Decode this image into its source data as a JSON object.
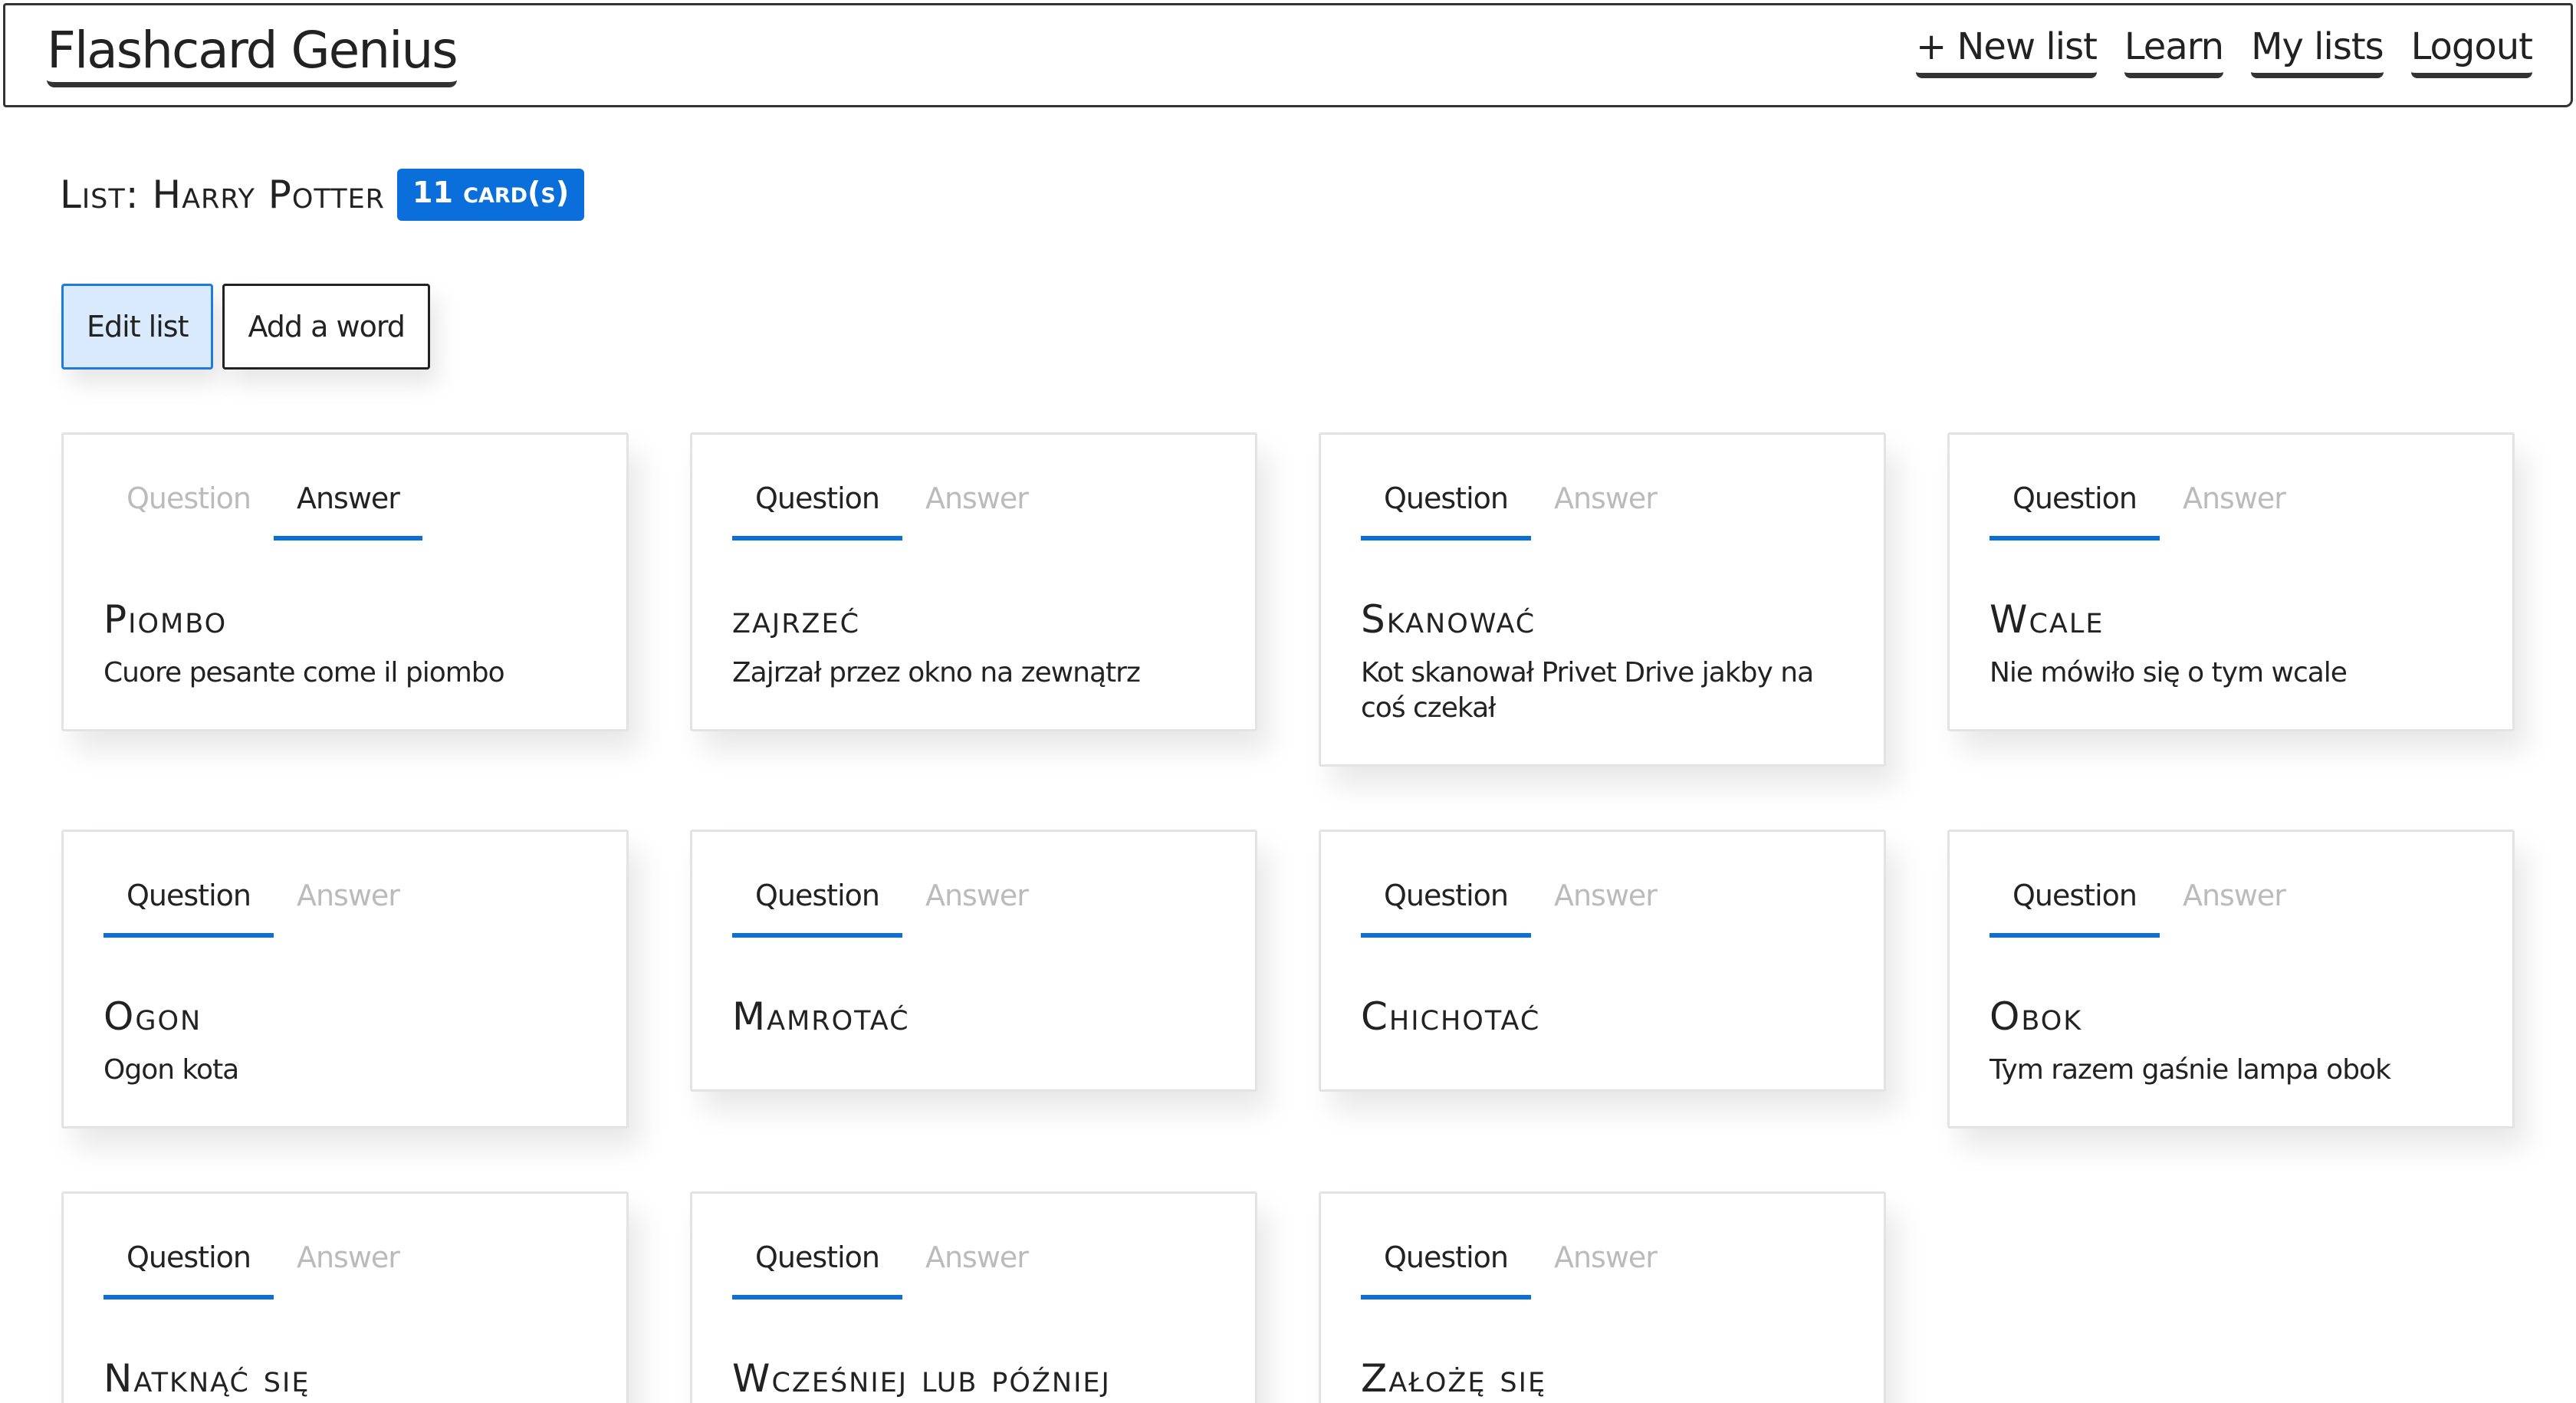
{
  "navbar": {
    "brand": "Flashcard Genius",
    "links": [
      "+ New list",
      "Learn",
      "My lists",
      "Logout"
    ]
  },
  "list": {
    "title": "List: Harry Potter",
    "count_badge": "11 card(s)"
  },
  "actions": {
    "edit_label": "Edit list",
    "add_label": "Add a word"
  },
  "tabs": {
    "question": "Question",
    "answer": "Answer"
  },
  "cards": [
    {
      "word": "Piombo",
      "example": "Cuore pesante come il piombo",
      "active_tab": "answer"
    },
    {
      "word": "zajrzeć",
      "example": "Zajrzał przez okno na zewnątrz",
      "active_tab": "question"
    },
    {
      "word": "Skanować",
      "example": "Kot skanował Privet Drive jakby na coś czekał",
      "active_tab": "question"
    },
    {
      "word": "Wcale",
      "example": "Nie mówiło się o tym wcale",
      "active_tab": "question"
    },
    {
      "word": "Ogon",
      "example": "Ogon kota",
      "active_tab": "question"
    },
    {
      "word": "Mamrotać",
      "example": "",
      "active_tab": "question"
    },
    {
      "word": "Chichotać",
      "example": "",
      "active_tab": "question"
    },
    {
      "word": "Obok",
      "example": "Tym razem gaśnie lampa obok",
      "active_tab": "question"
    },
    {
      "word": "Natknąć się",
      "example": "",
      "active_tab": "question"
    },
    {
      "word": "Wcześniej lub później",
      "example": "",
      "active_tab": "question"
    },
    {
      "word": "Założę się",
      "example": "",
      "active_tab": "question"
    }
  ]
}
